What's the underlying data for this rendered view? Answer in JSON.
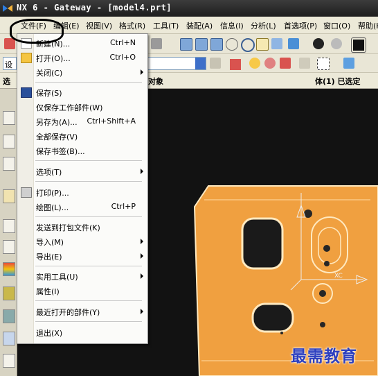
{
  "window": {
    "title": "NX 6 - Gateway - [model4.prt]"
  },
  "menubar": {
    "items": [
      {
        "label": "文件(F)"
      },
      {
        "label": "编辑(E)"
      },
      {
        "label": "视图(V)"
      },
      {
        "label": "格式(R)"
      },
      {
        "label": "工具(T)"
      },
      {
        "label": "装配(A)"
      },
      {
        "label": "信息(I)"
      },
      {
        "label": "分析(L)"
      },
      {
        "label": "首选项(P)"
      },
      {
        "label": "窗口(O)"
      },
      {
        "label": "帮助(H)"
      }
    ]
  },
  "toolbar2": {
    "dropdown_text": "设"
  },
  "selection_bar": {
    "left_label": "选",
    "filter_label": "对象",
    "status": "体(1) 已选定"
  },
  "file_menu": {
    "items": [
      {
        "label": "新建(N)...",
        "shortcut": "Ctrl+N"
      },
      {
        "label": "打开(O)...",
        "shortcut": "Ctrl+O"
      },
      {
        "label": "关闭(C)"
      },
      {
        "label": "保存(S)"
      },
      {
        "label": "仅保存工作部件(W)"
      },
      {
        "label": "另存为(A)...",
        "shortcut": "Ctrl+Shift+A"
      },
      {
        "label": "全部保存(V)"
      },
      {
        "label": "保存书签(B)..."
      },
      {
        "label": "选项(T)"
      },
      {
        "label": "打印(P)..."
      },
      {
        "label": "绘图(L)...",
        "shortcut": "Ctrl+P"
      },
      {
        "label": "发送到打包文件(K)"
      },
      {
        "label": "导入(M)"
      },
      {
        "label": "导出(E)"
      },
      {
        "label": "实用工具(U)"
      },
      {
        "label": "属性(I)"
      },
      {
        "label": "最近打开的部件(Y)"
      },
      {
        "label": "退出(X)"
      }
    ]
  },
  "viewport": {
    "axis_label": "XC"
  },
  "watermark": {
    "text": "最需教育"
  },
  "colors": {
    "part": "#f0a040",
    "part_edge": "#ffe9c0",
    "accent_blue": "#2c3fbf"
  }
}
